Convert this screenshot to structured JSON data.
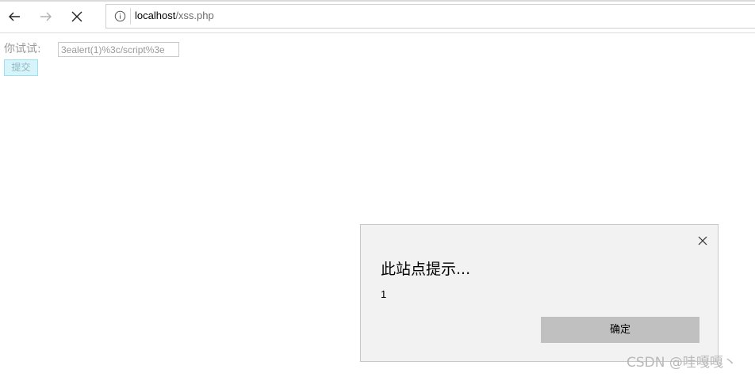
{
  "browser": {
    "url_host": "localhost",
    "url_path": "/xss.php",
    "icons": {
      "back": "back-arrow-icon",
      "forward": "forward-arrow-icon",
      "stop": "close-icon",
      "site_info": "info-icon"
    }
  },
  "form": {
    "label": "你试试:",
    "input_value": "3ealert(1)%3c/script%3e",
    "submit_label": "提交"
  },
  "alert_dialog": {
    "title": "此站点提示...",
    "message": "1",
    "ok_label": "确定",
    "icons": {
      "close": "close-icon"
    }
  },
  "watermark": "CSDN @哇嘎嘎丶",
  "colors": {
    "dialog_bg": "#f2f2f2",
    "ok_button_bg": "#c0c0c0",
    "submit_bg": "#d8f4fb",
    "submit_border": "#9fe0ee"
  }
}
